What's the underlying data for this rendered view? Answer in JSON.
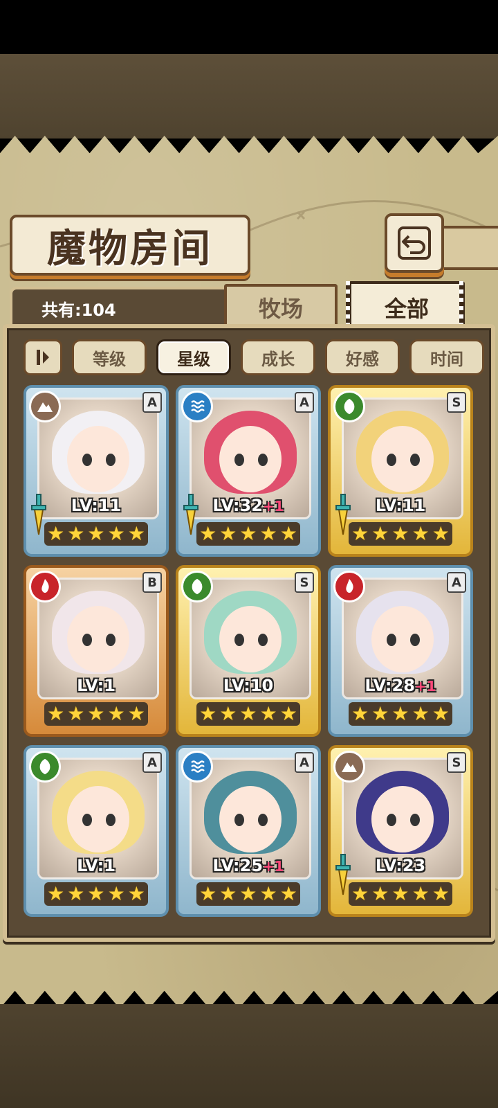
{
  "screen": {
    "title": "魔物房间",
    "back_icon": "back-arrow-icon"
  },
  "summary": {
    "count_label": "共有:104"
  },
  "tabs": [
    {
      "label": "牧场",
      "active": false
    },
    {
      "label": "全部",
      "active": true
    }
  ],
  "sort": {
    "toggle_icon": "sort-order-icon",
    "options": [
      {
        "label": "等级",
        "active": false
      },
      {
        "label": "星级",
        "active": true
      },
      {
        "label": "成长",
        "active": false
      },
      {
        "label": "好感",
        "active": false
      },
      {
        "label": "时间",
        "active": false
      }
    ]
  },
  "monsters": [
    {
      "element": "earth",
      "rank": "A",
      "level": "LV:11",
      "plus": "",
      "stars": 5,
      "has_weapon": true,
      "hair": "#f2f0f4"
    },
    {
      "element": "water",
      "rank": "A",
      "level": "LV:32",
      "plus": "+1",
      "stars": 5,
      "has_weapon": true,
      "hair": "#e0506e"
    },
    {
      "element": "wind",
      "rank": "S",
      "level": "LV:11",
      "plus": "",
      "stars": 5,
      "has_weapon": true,
      "hair": "#f2d27a"
    },
    {
      "element": "fire",
      "rank": "B",
      "level": "LV:1",
      "plus": "",
      "stars": 5,
      "has_weapon": false,
      "hair": "#f1e6ea"
    },
    {
      "element": "wind",
      "rank": "S",
      "level": "LV:10",
      "plus": "",
      "stars": 5,
      "has_weapon": false,
      "hair": "#9fd8c4"
    },
    {
      "element": "fire",
      "rank": "A",
      "level": "LV:28",
      "plus": "+1",
      "stars": 5,
      "has_weapon": false,
      "hair": "#e6e2ee"
    },
    {
      "element": "wind",
      "rank": "A",
      "level": "LV:1",
      "plus": "",
      "stars": 5,
      "has_weapon": false,
      "hair": "#f4dc88"
    },
    {
      "element": "water",
      "rank": "A",
      "level": "LV:25",
      "plus": "+1",
      "stars": 5,
      "has_weapon": false,
      "hair": "#4f8f9c"
    },
    {
      "element": "earth",
      "rank": "S",
      "level": "LV:23",
      "plus": "",
      "stars": 5,
      "has_weapon": true,
      "hair": "#3f3a8a"
    }
  ],
  "colors": {
    "fire": "#c8242a",
    "water": "#2a7fc4",
    "wind": "#3b8a2c",
    "earth": "#8a6a54",
    "star": "#ffd43a",
    "plus": "#ff4a7a"
  }
}
